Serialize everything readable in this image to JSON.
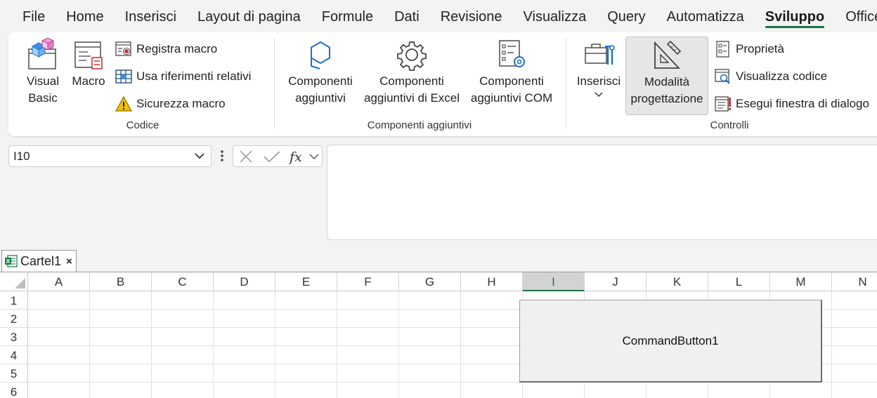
{
  "menu": {
    "tabs": [
      {
        "label": "File"
      },
      {
        "label": "Home"
      },
      {
        "label": "Inserisci"
      },
      {
        "label": "Layout di pagina"
      },
      {
        "label": "Formule"
      },
      {
        "label": "Dati"
      },
      {
        "label": "Revisione"
      },
      {
        "label": "Visualizza"
      },
      {
        "label": "Query"
      },
      {
        "label": "Automatizza"
      },
      {
        "label": "Sviluppo"
      },
      {
        "label": "Office T"
      }
    ],
    "active": "Sviluppo"
  },
  "ribbon": {
    "codice": {
      "label": "Codice",
      "visual_basic": {
        "line1": "Visual",
        "line2": "Basic"
      },
      "macro": "Macro",
      "registra_macro": "Registra macro",
      "usa_riferimenti": "Usa riferimenti relativi",
      "sicurezza_macro": "Sicurezza macro"
    },
    "componenti": {
      "label": "Componenti aggiuntivi",
      "comp_agg": {
        "line1": "Componenti",
        "line2": "aggiuntivi"
      },
      "comp_excel": {
        "line1": "Componenti",
        "line2": "aggiuntivi di Excel"
      },
      "comp_com": {
        "line1": "Componenti",
        "line2": "aggiuntivi COM"
      }
    },
    "controlli": {
      "label": "Controlli",
      "inserisci": "Inserisci",
      "modalita": {
        "line1": "Modalità",
        "line2": "progettazione"
      },
      "proprieta": "Proprietà",
      "visualizza_codice": "Visualizza codice",
      "esegui_finestra": "Esegui finestra di dialogo"
    }
  },
  "formula_bar": {
    "name_box": "I10"
  },
  "workbook_tab": {
    "name": "Cartel1",
    "close": "×"
  },
  "grid": {
    "columns": [
      "A",
      "B",
      "C",
      "D",
      "E",
      "F",
      "G",
      "H",
      "I",
      "J",
      "K",
      "L",
      "M",
      "N"
    ],
    "selected_column": "I",
    "rows": [
      "1",
      "2",
      "3",
      "4",
      "5",
      "6"
    ]
  },
  "command_button": {
    "label": "CommandButton1"
  },
  "colors": {
    "accent": "#1e7145",
    "excel_green": "#107c41",
    "icon_blue": "#1f6fc5",
    "warning_yellow": "#f2c200",
    "record_red": "#d13438"
  }
}
